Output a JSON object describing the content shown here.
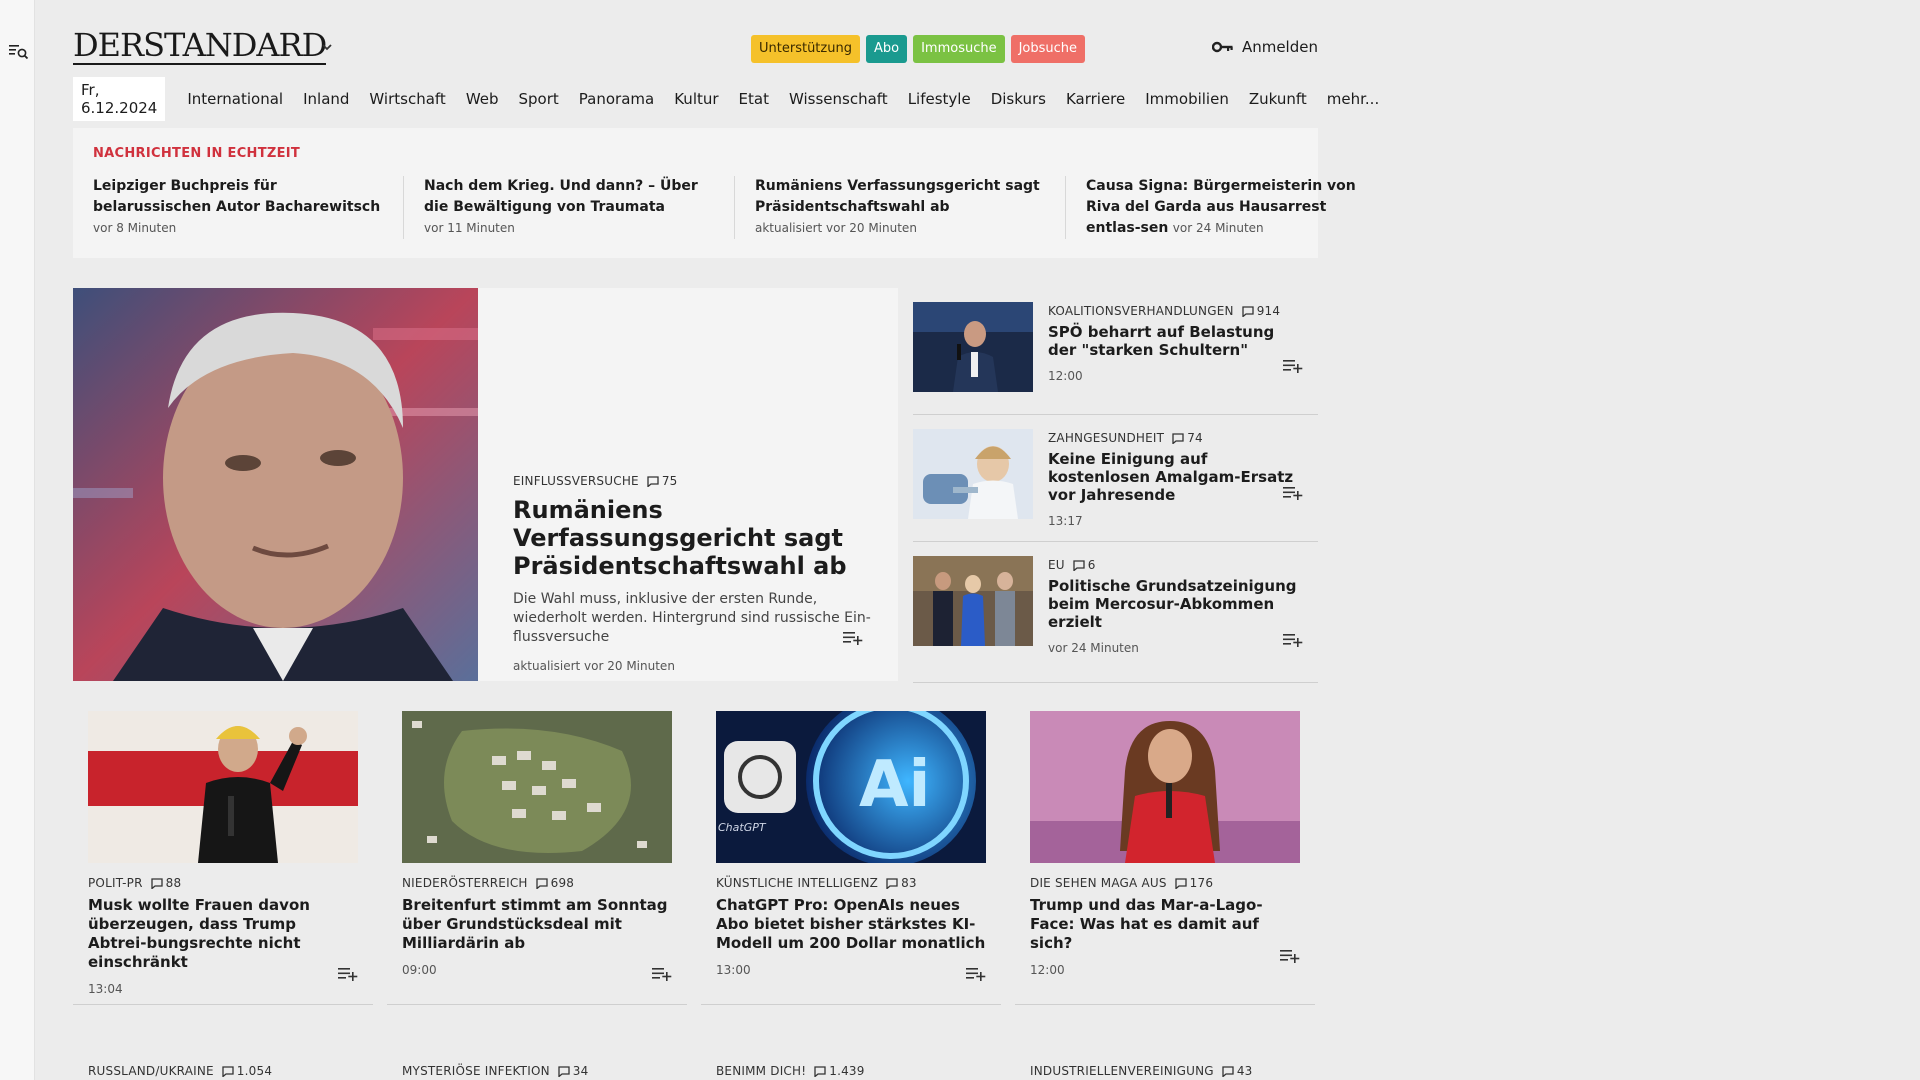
{
  "header": {
    "logo": "DERSTANDARD",
    "pills": [
      {
        "label": "Unterstützung",
        "bg": "#f5c12a",
        "fg": "#3a2a00"
      },
      {
        "label": "Abo",
        "bg": "#1a9a8f",
        "fg": "#ffffff"
      },
      {
        "label": "Immosuche",
        "bg": "#7bc243",
        "fg": "#ffffff"
      },
      {
        "label": "Jobsuche",
        "bg": "#ef6f67",
        "fg": "#ffffff"
      }
    ],
    "login_label": "Anmelden"
  },
  "nav": {
    "date": "Fr, 6.12.2024",
    "items": [
      "International",
      "Inland",
      "Wirtschaft",
      "Web",
      "Sport",
      "Panorama",
      "Kultur",
      "Etat",
      "Wissenschaft",
      "Lifestyle",
      "Diskurs",
      "Karriere",
      "Immobilien",
      "Zukunft",
      "mehr..."
    ]
  },
  "live": {
    "label": "NACHRICHTEN IN ECHTZEIT",
    "items": [
      {
        "title": "Leipziger Buchpreis für belarussischen Autor Bacharewitsch",
        "meta": "vor 8 Minuten"
      },
      {
        "title": "Nach dem Krieg. Und dann? – Über die Bewältigung von Traumata",
        "meta": "vor 11 Minuten"
      },
      {
        "title": "Rumäniens Verfassungsgericht sagt Präsidentschaftswahl ab",
        "meta": "aktualisiert vor 20 Minuten"
      },
      {
        "title": "Causa Signa: Bürgermeisterin von Riva del Garda aus Hausarrest entlas-sen",
        "meta": "vor 24 Minuten"
      }
    ]
  },
  "lead": {
    "kicker": "EINFLUSSVERSUCHE",
    "comments": "75",
    "title": "Rumäniens Verfassungsgericht sagt Präsidentschaftswahl ab",
    "teaser": "Die Wahl muss, inklusive der ersten Runde, wiederholt werden. Hintergrund sind russische Ein-flussversuche",
    "meta": "aktualisiert vor 20 Minuten"
  },
  "side": [
    {
      "kicker": "KOALITIONSVERHANDLUNGEN",
      "comments": "914",
      "title": "SPÖ beharrt auf Belastung der \"starken Schultern\"",
      "meta": "12:00"
    },
    {
      "kicker": "ZAHNGESUNDHEIT",
      "comments": "74",
      "title": "Keine Einigung auf kostenlosen Amalgam-Ersatz vor Jahresende",
      "meta": "13:17"
    },
    {
      "kicker": "EU",
      "comments": "6",
      "title": "Politische Grundsatzeinigung beim Mercosur-Abkommen erzielt",
      "meta": "vor 24 Minuten"
    }
  ],
  "cards": [
    {
      "kicker": "POLIT-PR",
      "comments": "88",
      "title": "Musk wollte Frauen davon überzeugen, dass Trump Abtrei-bungsrechte nicht einschränkt",
      "meta": "13:04"
    },
    {
      "kicker": "NIEDERÖSTERREICH",
      "comments": "698",
      "title": "Breitenfurt stimmt am Sonntag über Grundstücksdeal mit Milliardärin ab",
      "meta": "09:00"
    },
    {
      "kicker": "KÜNSTLICHE INTELLIGENZ",
      "comments": "83",
      "title": "ChatGPT Pro: OpenAIs neues Abo bietet bisher stärkstes KI-Modell um 200 Dollar monatlich",
      "meta": "13:00"
    },
    {
      "kicker": "DIE SEHEN MAGA AUS",
      "comments": "176",
      "title": "Trump und das Mar-a-Lago-Face: Was hat es damit auf sich?",
      "meta": "12:00"
    }
  ],
  "row2": [
    {
      "kicker": "RUSSLAND/UKRAINE",
      "comments": "1.054"
    },
    {
      "kicker": "MYSTERIÖSE INFEKTION",
      "comments": "34"
    },
    {
      "kicker": "BENIMM DICH!",
      "comments": "1.439"
    },
    {
      "kicker": "INDUSTRIELLENVEREINIGUNG",
      "comments": "43"
    }
  ],
  "images": {
    "chatgpt_text": "ChatGPT",
    "ai_text": "Ai"
  }
}
